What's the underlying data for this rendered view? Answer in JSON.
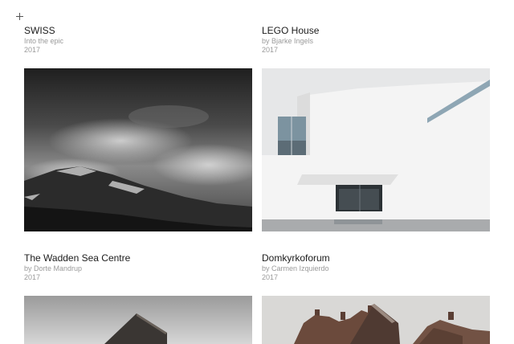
{
  "projects": [
    {
      "title": "SWISS",
      "byline": "Into the epic",
      "year": "2017",
      "photo_icon": "stormy-mountain-photo"
    },
    {
      "title": "LEGO House",
      "byline": "by Bjarke Ingels",
      "year": "2017",
      "photo_icon": "white-building-photo"
    },
    {
      "title": "The Wadden Sea Centre",
      "byline": "by Dorte Mandrup",
      "year": "2017",
      "photo_icon": "thatched-roof-photo"
    },
    {
      "title": "Domkyrkoforum",
      "byline": "by Carmen Izquierdo",
      "year": "2017",
      "photo_icon": "brick-gables-photo"
    }
  ]
}
